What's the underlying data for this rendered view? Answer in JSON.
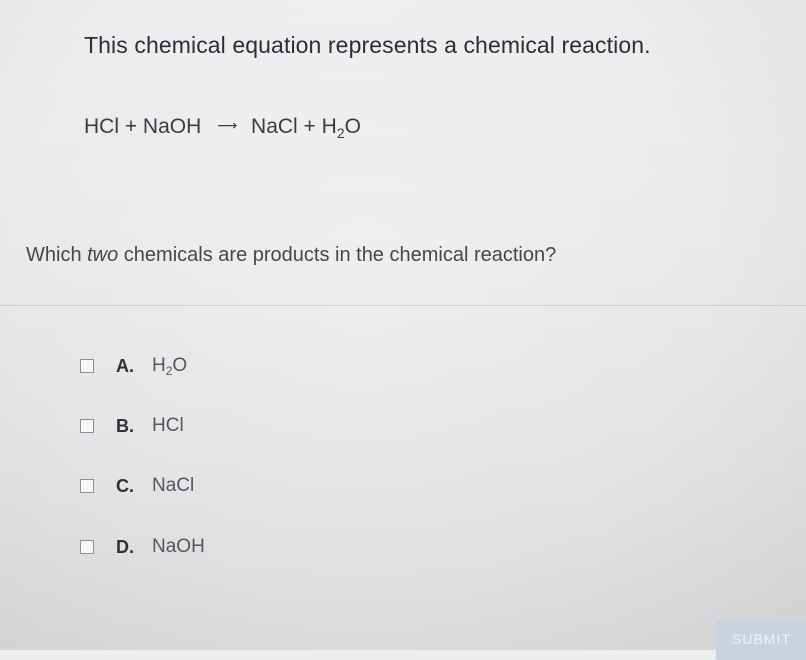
{
  "question": {
    "intro": "This chemical equation represents a chemical reaction."
  },
  "equation": {
    "reactants": "HCl + NaOH",
    "arrow": "⟶",
    "products_before_sub": "NaCl + H",
    "products_sub": "2",
    "products_after_sub": "O"
  },
  "prompt": {
    "before": "Which ",
    "emphasis": "two",
    "after": " chemicals are products in the chemical reaction?"
  },
  "options": [
    {
      "letter": "A.",
      "text_before_sub": "H",
      "text_sub": "2",
      "text_after_sub": "O"
    },
    {
      "letter": "B.",
      "text": "HCl"
    },
    {
      "letter": "C.",
      "text": "NaCl"
    },
    {
      "letter": "D.",
      "text": "NaOH"
    }
  ],
  "submit": {
    "label": "SUBMIT"
  }
}
